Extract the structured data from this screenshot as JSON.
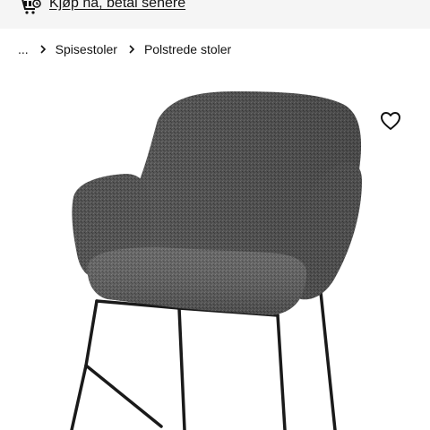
{
  "promo": {
    "link_text": "Kjøp nå, betal senere",
    "icon": "cart-clock-icon"
  },
  "breadcrumb": {
    "items": [
      "...",
      "Spisestoler",
      "Polstrede stoler"
    ],
    "separator_icon": "chevron-right-icon"
  },
  "product": {
    "image": "upholstered-armchair-grey-fabric-black-metal-legs",
    "favourite_icon": "heart-outline-icon"
  },
  "colors": {
    "banner_bg": "#f5f5f5",
    "text": "#111111",
    "fabric": "#5a5a5a",
    "legs": "#1a1a1a"
  }
}
